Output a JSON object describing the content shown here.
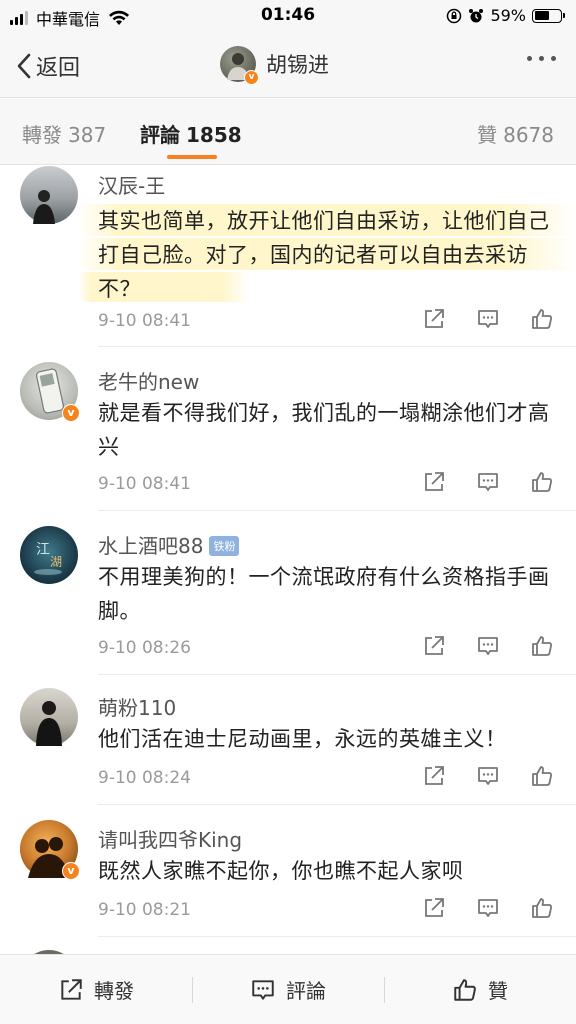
{
  "status_bar": {
    "carrier": "中華電信",
    "time": "01:46",
    "battery": "59%"
  },
  "nav": {
    "back_label": "返回",
    "title": "胡锡进",
    "verified_mark": "v"
  },
  "tabs": {
    "repost_label": "轉發",
    "repost_count": "387",
    "comment_label": "評論",
    "comment_count": "1858",
    "like_label": "贊",
    "like_count": "8678"
  },
  "comments": [
    {
      "name": "汉辰-王",
      "text": "其实也简单，放开让他们自由采访，让他们自己打自己脸。对了，国内的记者可以自由去采访不？",
      "time": "9-10 08:41",
      "verified": false,
      "highlighted": true
    },
    {
      "name": "老牛的new",
      "text": "就是看不得我们好，我们乱的一塌糊涂他们才高兴",
      "time": "9-10 08:41",
      "verified": true
    },
    {
      "name": "水上酒吧88",
      "badge": "铁粉",
      "text": "不用理美狗的！一个流氓政府有什么资格指手画脚。",
      "time": "9-10 08:26",
      "verified": false
    },
    {
      "name": "萌粉110",
      "text": "他们活在迪士尼动画里，永远的英雄主义！",
      "time": "9-10 08:24",
      "verified": false
    },
    {
      "name": "请叫我四爷King",
      "text": "既然人家瞧不起你，你也瞧不起人家呗",
      "time": "9-10 08:21",
      "verified": true
    }
  ],
  "bottom_bar": {
    "repost": "轉發",
    "comment": "評論",
    "like": "贊"
  },
  "colors": {
    "accent": "#f5821f",
    "verified": "#f6841e",
    "fan_badge": "#8fb3de"
  }
}
